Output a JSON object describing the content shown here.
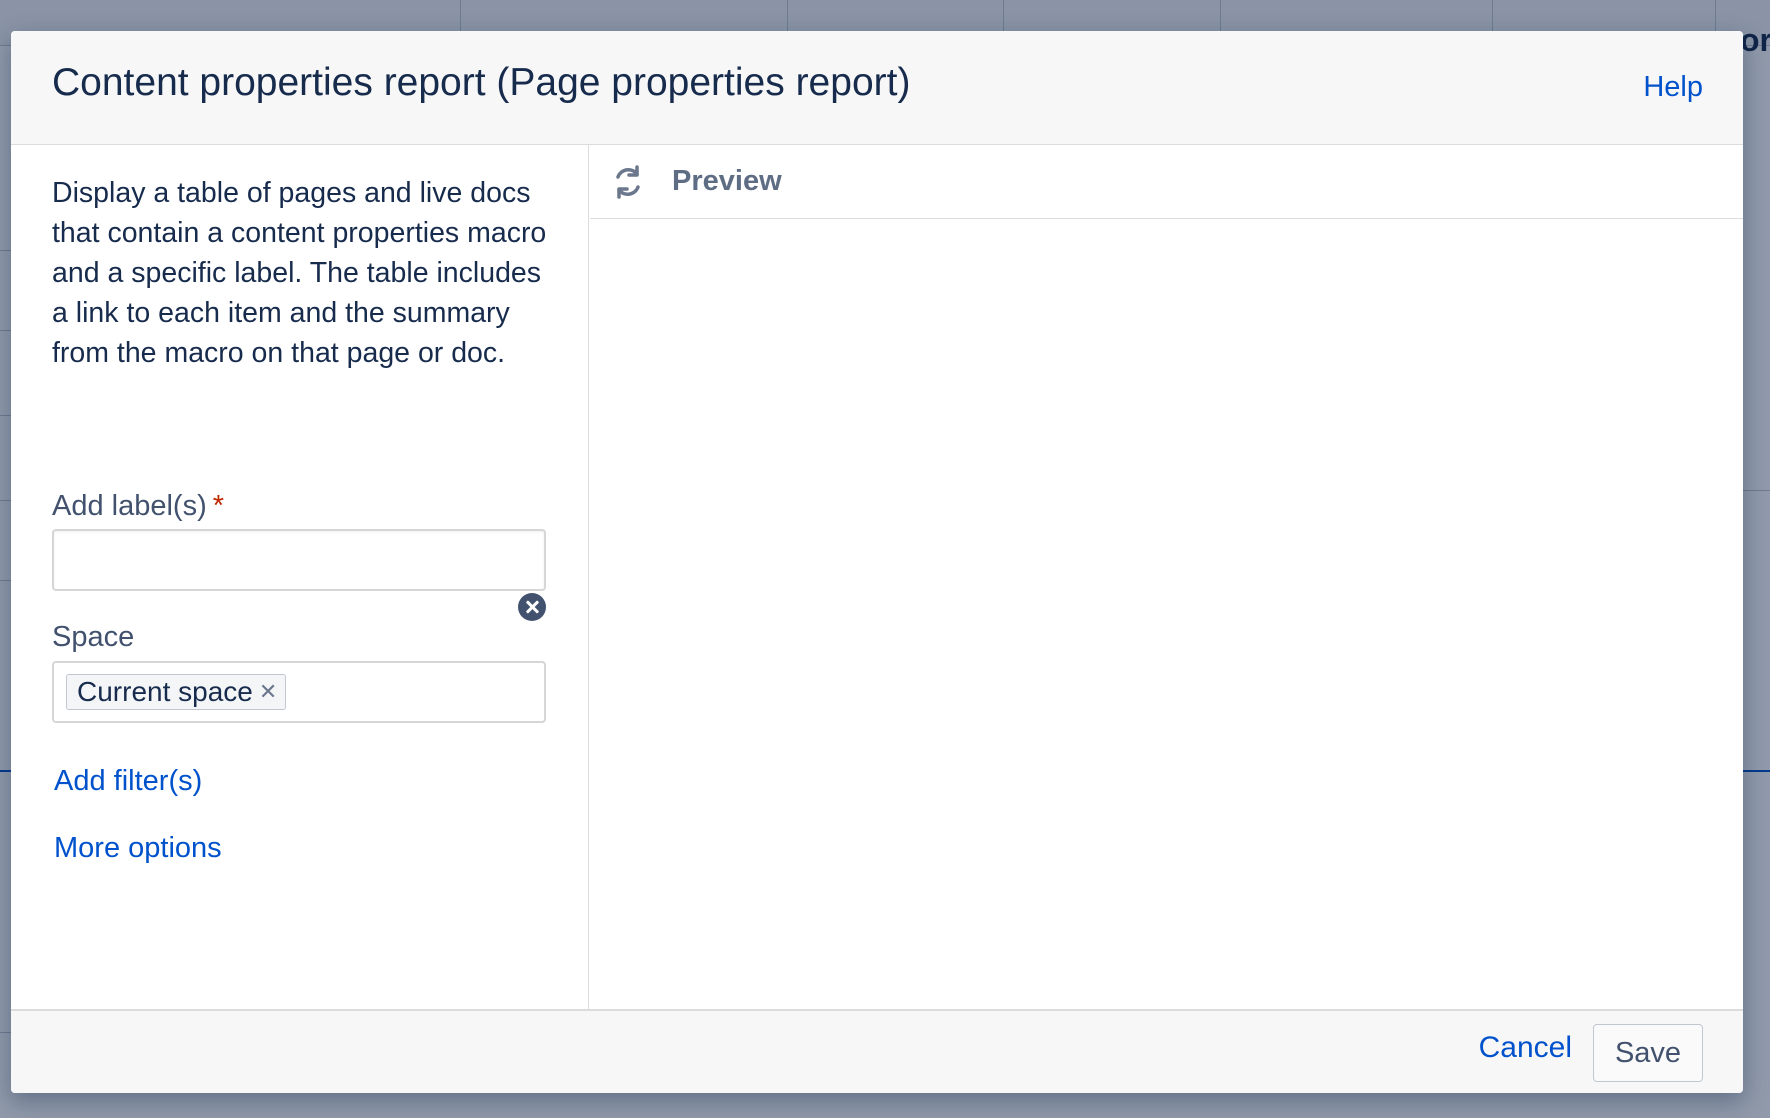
{
  "dialog": {
    "title": "Content properties report (Page properties report)",
    "help_label": "Help",
    "description": "Display a table of pages and live docs that contain a content properties macro and a specific label. The table includes a link to each item and the summary from the macro on that page or doc.",
    "labels_field": {
      "label": "Add label(s)",
      "required_mark": "*",
      "value": ""
    },
    "space_field": {
      "label": "Space",
      "selected": [
        {
          "label": "Current space"
        }
      ],
      "clear_icon": "close-circle-icon"
    },
    "add_filter_label": "Add filter(s)",
    "more_options_label": "More options",
    "preview": {
      "label": "Preview",
      "icon": "refresh-icon"
    },
    "footer": {
      "cancel_label": "Cancel",
      "save_label": "Save"
    }
  },
  "background": {
    "header_fragment": "or"
  },
  "colors": {
    "link": "#0052cc",
    "required": "#bf2600",
    "text": "#172b4d",
    "muted": "#42526e",
    "overlay": "#091e42"
  }
}
